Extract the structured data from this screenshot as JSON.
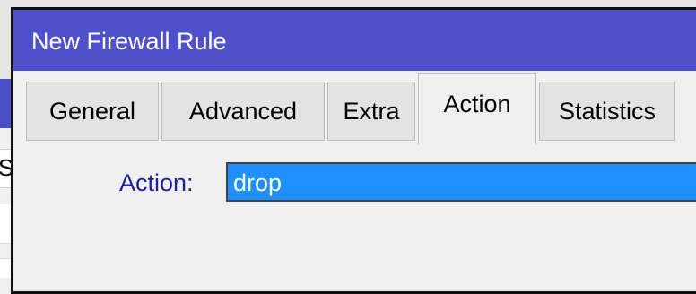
{
  "background_window": {
    "header_fragment": "St"
  },
  "dialog": {
    "title": "New Firewall Rule",
    "tabs": [
      {
        "label": "General",
        "active": false
      },
      {
        "label": "Advanced",
        "active": false
      },
      {
        "label": "Extra",
        "active": false
      },
      {
        "label": "Action",
        "active": true
      },
      {
        "label": "Statistics",
        "active": false
      }
    ],
    "action_field": {
      "label": "Action:",
      "value": "drop"
    }
  },
  "colors": {
    "titlebar": "#4e51c9",
    "selection": "#1e90ff",
    "label_text": "#1f1f9e"
  }
}
